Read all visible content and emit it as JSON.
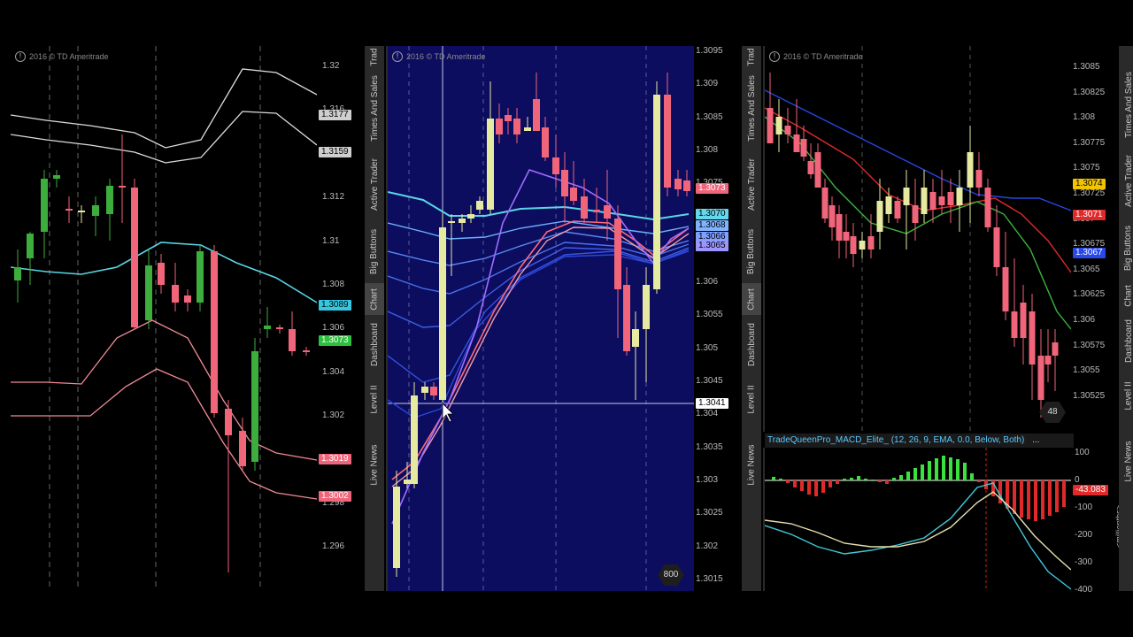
{
  "colors": {
    "bull": "#e6e9a0",
    "bull_green": "#3dae3d",
    "bear": "#f0657a",
    "mid_bg": "#0c0d5e",
    "cyan": "#5ad6e6"
  },
  "copyright": "2016 © TD Ameritrade",
  "left": {
    "ticks": [
      "1.32",
      "1.316",
      "1.314",
      "1.312",
      "1.31",
      "1.308",
      "1.306",
      "1.304",
      "1.302",
      "1.3",
      "1.298",
      "1.296"
    ],
    "tags": [
      {
        "text": "1.3177",
        "bg": "#cfcfcf",
        "fg": "#000"
      },
      {
        "text": "1.3159",
        "bg": "#cfcfcf",
        "fg": "#000"
      },
      {
        "text": "1.3089",
        "bg": "#35c8e0",
        "fg": "#000"
      },
      {
        "text": "1.3073",
        "bg": "#2fbf3f",
        "fg": "#fff"
      },
      {
        "text": "1.3019",
        "bg": "#f0657a",
        "fg": "#fff"
      },
      {
        "text": "1.3002",
        "bg": "#f0657a",
        "fg": "#fff"
      }
    ]
  },
  "mid": {
    "ticks": [
      "1.3095",
      "1.309",
      "1.3085",
      "1.308",
      "1.3075",
      "1.307",
      "1.3065",
      "1.306",
      "1.3055",
      "1.305",
      "1.3045",
      "1.304",
      "1.3035",
      "1.303",
      "1.3025",
      "1.302",
      "1.3015"
    ],
    "tags": [
      {
        "text": "1.3073",
        "bg": "#f0657a",
        "fg": "#fff"
      },
      {
        "text": "1.3070",
        "bg": "#63d8ec",
        "fg": "#000"
      },
      {
        "text": "1.3068",
        "bg": "#7fb2ff",
        "fg": "#000"
      },
      {
        "text": "1.3066",
        "bg": "#7fa0ff",
        "fg": "#000"
      },
      {
        "text": "1.3065",
        "bg": "#9d95ff",
        "fg": "#000"
      },
      {
        "text": "1.3041",
        "bg": "#ffffff",
        "fg": "#000"
      }
    ],
    "badge": "800"
  },
  "right": {
    "ticks": [
      "1.3085",
      "1.30825",
      "1.308",
      "1.30775",
      "1.3075",
      "1.30725",
      "1.307",
      "1.30675",
      "1.3065",
      "1.30625",
      "1.306",
      "1.30575",
      "1.3055",
      "1.30525"
    ],
    "tags": [
      {
        "text": "1.3074",
        "bg": "#f2c400",
        "fg": "#000"
      },
      {
        "text": "1.3071",
        "bg": "#e02a2a",
        "fg": "#fff"
      },
      {
        "text": "1.3067",
        "bg": "#2848e8",
        "fg": "#fff"
      }
    ],
    "badge": "48",
    "macd": {
      "title": "TradeQueenPro_MACD_Elite_ (12, 26, 9, EMA, 0.0, Below, Both)",
      "menu": "...",
      "ticks": [
        "100",
        "0",
        "-100",
        "-200",
        "-300",
        "-400"
      ],
      "unit": "<millionths>",
      "value_tag": "-43.083"
    }
  },
  "tabs_a": [
    "Trad",
    "Times And Sales",
    "Active Trader",
    "Big Buttons",
    "Chart",
    "Dashboard",
    "Level II",
    "Live News"
  ],
  "tabs_b": [
    "Trad",
    "Times And Sales",
    "Active Trader",
    "Big Buttons",
    "Chart",
    "Dashboard",
    "Level II",
    "Live News"
  ],
  "tabs_c": [
    "Times And Sales",
    "Active Trader",
    "Big Buttons",
    "Chart",
    "Dashboard",
    "Level II",
    "Live News"
  ]
}
